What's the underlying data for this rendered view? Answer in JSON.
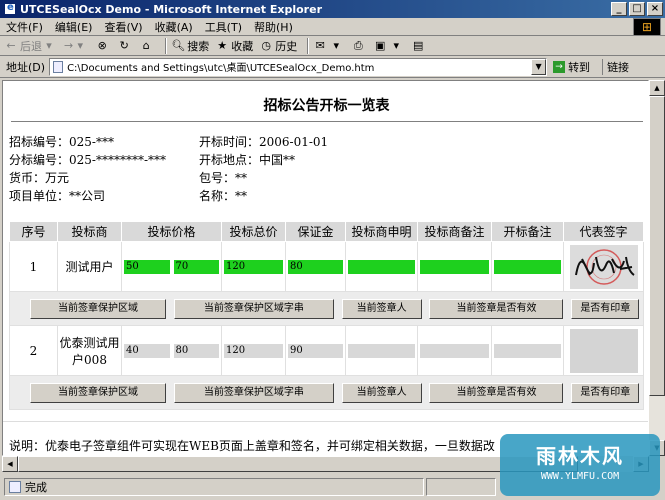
{
  "window": {
    "title": "UTCESealOcx Demo - Microsoft Internet Explorer",
    "btn_min": "_",
    "btn_max": "□",
    "btn_close": "×"
  },
  "menu": [
    "文件(F)",
    "编辑(E)",
    "查看(V)",
    "收藏(A)",
    "工具(T)",
    "帮助(H)"
  ],
  "toolbar": {
    "back": "后退",
    "forward": "→",
    "search": "搜索",
    "favorites": "收藏",
    "history": "历史"
  },
  "address": {
    "label": "地址(D)",
    "value": "C:\\Documents and Settings\\utc\\桌面\\UTCESealOcx_Demo.htm",
    "go": "转到",
    "links": "链接"
  },
  "page": {
    "title": "招标公告开标一览表",
    "info": {
      "bid_no": "招标编号：025-***",
      "sub_no": "分标编号：025-********-***",
      "currency": "货币：万元",
      "unit": "项目单位：**公司",
      "open_time": "开标时间：2006-01-01",
      "open_place": "开标地点：中国**",
      "pkg_no": "包号：**",
      "name": "名称：**"
    },
    "table": {
      "headers": [
        "序号",
        "投标商",
        "投标价格",
        "投标总价",
        "保证金",
        "投标商申明",
        "投标商备注",
        "开标备注",
        "代表签字"
      ],
      "rows": [
        {
          "seq": "1",
          "bidder": "测试用户",
          "price": "50",
          "price2": "70",
          "total": "120",
          "deposit": "80"
        },
        {
          "seq": "2",
          "bidder": "优泰测试用户008",
          "price": "40",
          "price2": "80",
          "total": "120",
          "deposit": "90"
        }
      ],
      "buttons": [
        "当前签章保护区域",
        "当前签章保护区域字串",
        "当前签章人",
        "当前签章是否有效",
        "是否有印章"
      ]
    },
    "note": "说明：优泰电子签章组件可实现在WEB页面上盖章和签名，并可绑定相关数据，一旦数据改"
  },
  "status": {
    "text": "完成"
  },
  "watermark": {
    "main": "雨林木风",
    "sub": "WWW.YLMFU.COM"
  }
}
